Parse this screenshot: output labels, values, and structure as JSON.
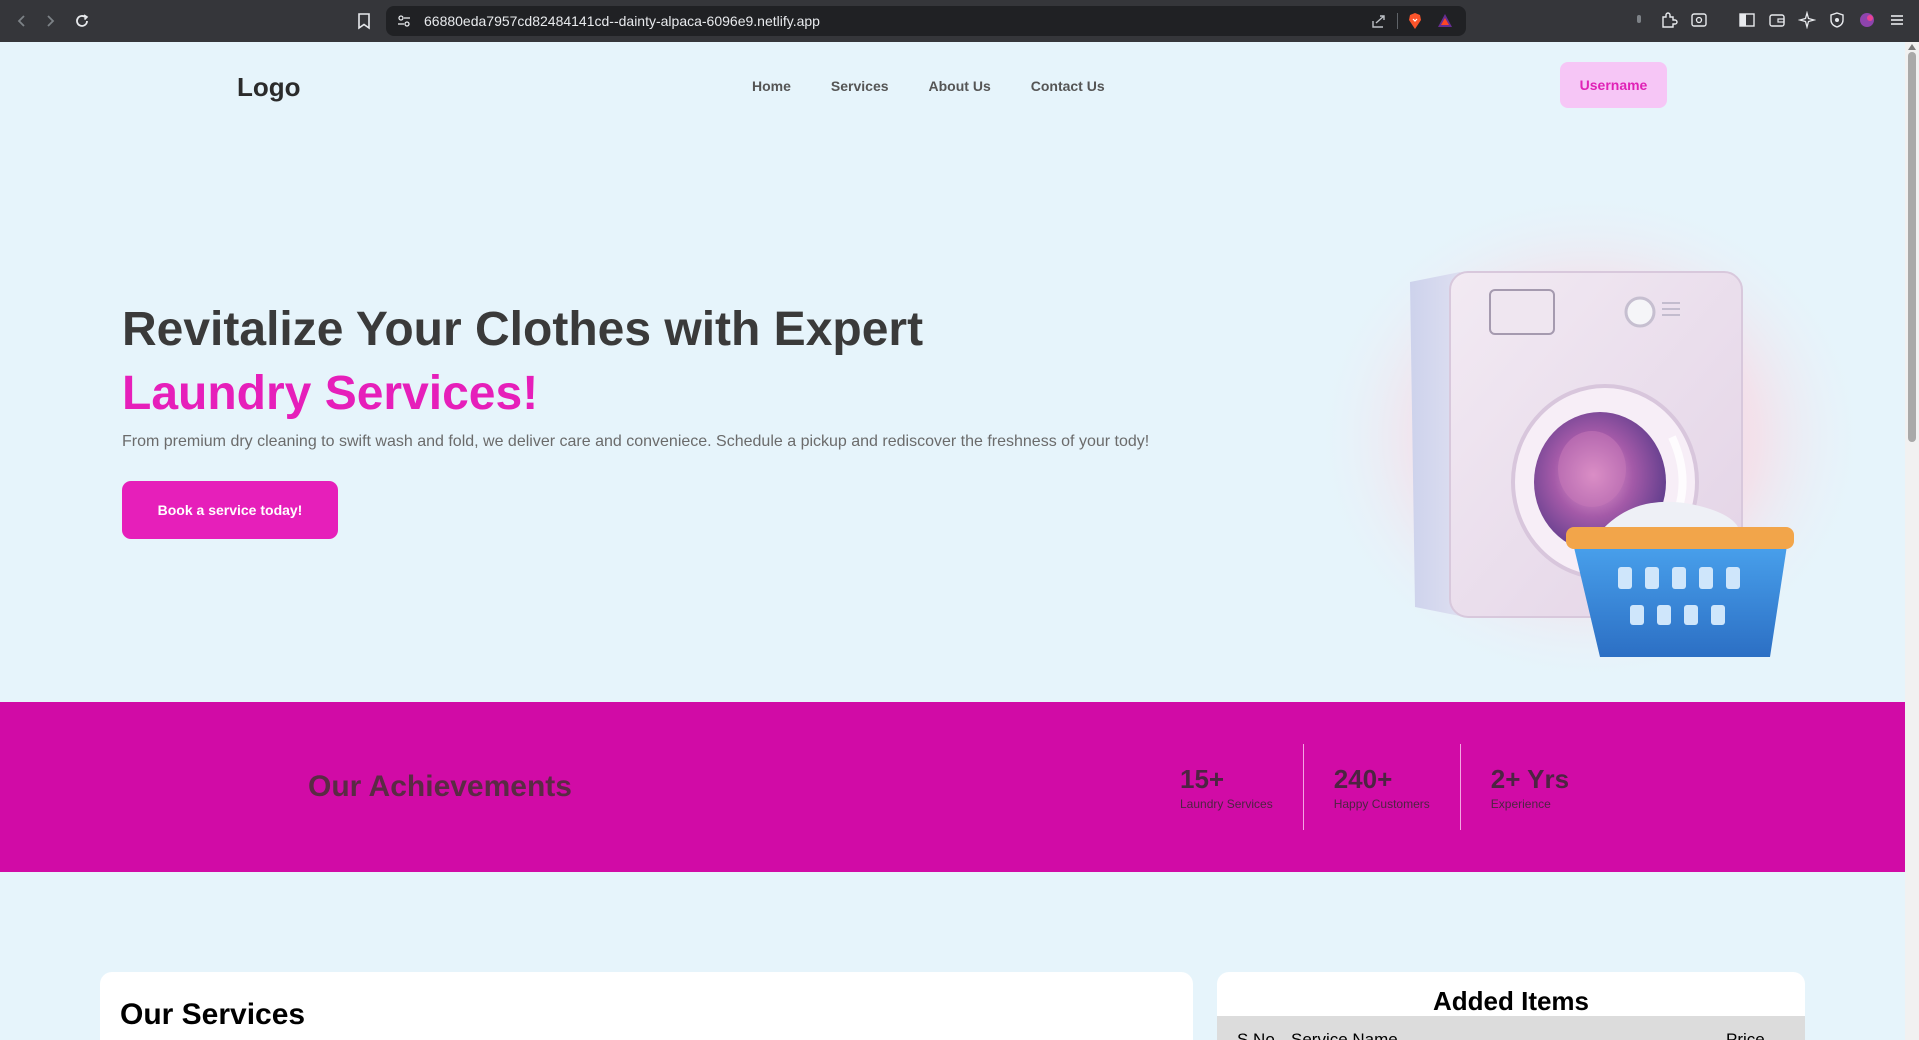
{
  "browser": {
    "url": "66880eda7957cd82484141cd--dainty-alpaca-6096e9.netlify.app"
  },
  "navbar": {
    "logo": "Logo",
    "links": [
      "Home",
      "Services",
      "About Us",
      "Contact Us"
    ],
    "user_button": "Username"
  },
  "hero": {
    "title_line1": "Revitalize Your Clothes with Expert",
    "title_line2": "Laundry Services!",
    "description": "From premium dry cleaning to swift wash and fold, we deliver care and conveniece. Schedule a pickup and rediscover the freshness of your tody!",
    "cta": "Book a service today!"
  },
  "achievements": {
    "title": "Our Achievements",
    "stats": [
      {
        "value": "15+",
        "label": "Laundry Services"
      },
      {
        "value": "240+",
        "label": "Happy Customers"
      },
      {
        "value": "2+ Yrs",
        "label": "Experience"
      }
    ]
  },
  "services": {
    "title": "Our Services"
  },
  "added_items": {
    "title": "Added Items",
    "columns": [
      "S.No.",
      "Service Name",
      "Price"
    ]
  },
  "colors": {
    "accent": "#e61fba",
    "band": "#d10ba6",
    "page_bg": "#e6f4fb"
  }
}
